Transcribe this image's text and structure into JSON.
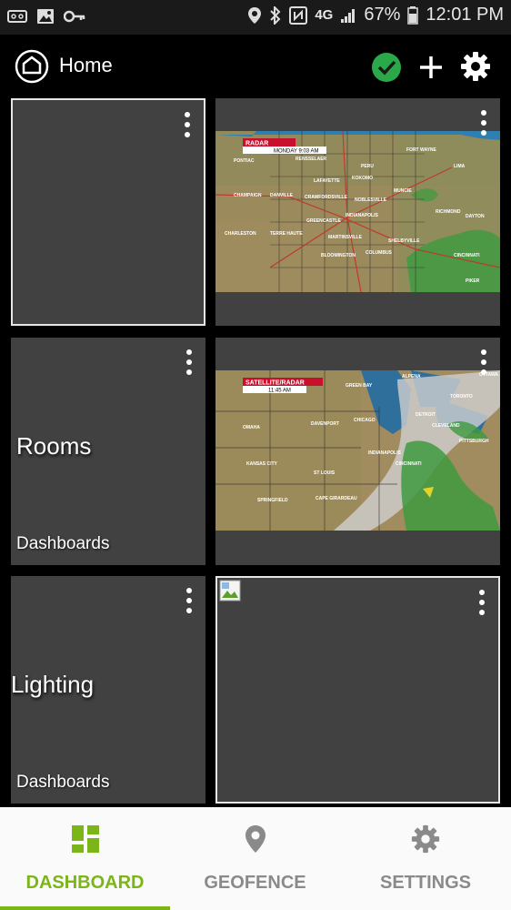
{
  "status_bar": {
    "battery": "67%",
    "time": "12:01 PM",
    "network": "4G"
  },
  "app_bar": {
    "title": "Home",
    "check_color": "#2aa84a"
  },
  "tiles": [
    {
      "id": "tile-1",
      "title": "",
      "subtitle": ""
    },
    {
      "id": "tile-2",
      "kind": "radar-map",
      "badge": "RADAR",
      "badge_sub": "MONDAY 9:03 AM"
    },
    {
      "id": "tile-3",
      "title": "Rooms",
      "subtitle": "Dashboards"
    },
    {
      "id": "tile-4",
      "kind": "satellite-map",
      "badge": "SATELLITE/RADAR",
      "badge_sub": "11:45 AM"
    },
    {
      "id": "tile-5",
      "title": "Lighting",
      "subtitle": "Dashboards"
    },
    {
      "id": "tile-6",
      "kind": "broken-image"
    }
  ],
  "radar_cities": [
    "FORT WAYNE",
    "PONTIAC",
    "RENSSELAER",
    "PERU",
    "LIMA",
    "LAFAYETTE",
    "KOKOMO",
    "MUNCIE",
    "CHAMPAIGN",
    "DANVILLE",
    "CRAWFORDSVILLE",
    "NOBLESVILLE",
    "RICHMOND",
    "DAYTON",
    "INDIANAPOLIS",
    "GREENCASTLE",
    "CHARLESTON",
    "TERRE HAUTE",
    "MARTINSVILLE",
    "SHELBYVILLE",
    "BLOOMINGTON",
    "COLUMBUS",
    "CINCINNATI",
    "PIKER"
  ],
  "satellite_cities": [
    "ALPENA",
    "GREEN BAY",
    "OTTAWA",
    "TORONTO",
    "DETROIT",
    "OMAHA",
    "DAVENPORT",
    "CHICAGO",
    "CLEVELAND",
    "PITTSBURGH",
    "INDIANAPOLIS",
    "KANSAS CITY",
    "ST LOUIS",
    "SPRINGFIELD",
    "CAPE GIRARDEAU",
    "CINCINNATI"
  ],
  "bottom_nav": {
    "items": [
      {
        "label": "DASHBOARD",
        "icon": "dashboard-icon",
        "active": true
      },
      {
        "label": "GEOFENCE",
        "icon": "location-pin-icon",
        "active": false
      },
      {
        "label": "SETTINGS",
        "icon": "gear-icon",
        "active": false
      }
    ],
    "accent": "#7cb518"
  }
}
